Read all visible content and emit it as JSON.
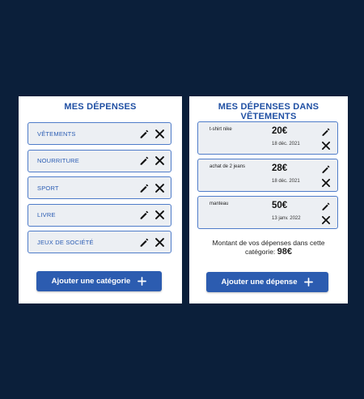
{
  "categories_panel": {
    "title": "MES DÉPENSES",
    "items": [
      {
        "label": "VÊTEMENTS"
      },
      {
        "label": "NOURRITURE"
      },
      {
        "label": "SPORT"
      },
      {
        "label": "LIVRE"
      },
      {
        "label": "JEUX DE SOCIÉTÉ"
      }
    ],
    "add_button_label": "Ajouter une catégorie"
  },
  "expenses_panel": {
    "title": "MES DÉPENSES DANS VÊTEMENTS",
    "items": [
      {
        "name": "t-shirt nike",
        "amount": "20€",
        "date": "18 déc. 2021"
      },
      {
        "name": "achat de 2 jeans",
        "amount": "28€",
        "date": "18 déc. 2021"
      },
      {
        "name": "manteau",
        "amount": "50€",
        "date": "13 janv. 2022"
      }
    ],
    "total_text": "Montant de vos dépenses dans cette catégorie:",
    "total_amount": "98€",
    "add_button_label": "Ajouter une dépense"
  },
  "colors": {
    "background": "#0b1f3a",
    "accent": "#2c5cb0",
    "title": "#1f4fa3",
    "item_border": "#4f7cc9",
    "item_background": "#eceff3"
  },
  "icons": {
    "edit": "pencil-icon",
    "delete": "close-icon",
    "add": "plus-icon"
  }
}
